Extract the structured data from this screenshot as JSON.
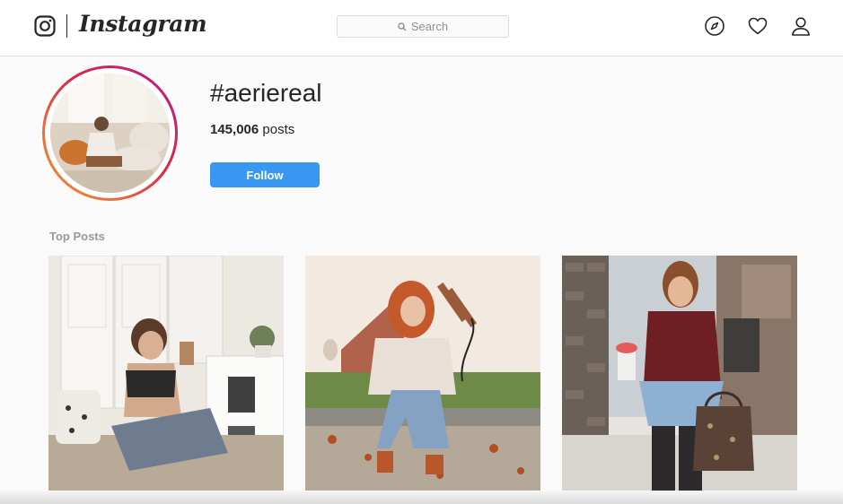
{
  "nav": {
    "wordmark": "Instagram",
    "search_placeholder": "Search",
    "icons": [
      "instagram-glyph-icon",
      "explore-compass-icon",
      "activity-heart-icon",
      "profile-icon"
    ]
  },
  "hashtag": {
    "title": "#aeriereal",
    "post_count": "145,006",
    "post_count_label": "posts",
    "follow_label": "Follow"
  },
  "sections": {
    "top_posts_title": "Top Posts"
  },
  "top_posts": [
    {
      "description": "woman sitting on floor in white room wearing lace bralette and ripped jeans"
    },
    {
      "description": "red-haired woman sitting on curb with flat iron, autumn leaves"
    },
    {
      "description": "woman in maroon henley holding drink and monogram handbag"
    }
  ],
  "colors": {
    "accent": "#3897f0",
    "text": "#262626",
    "muted": "#999999",
    "border": "#dbdbdb"
  }
}
